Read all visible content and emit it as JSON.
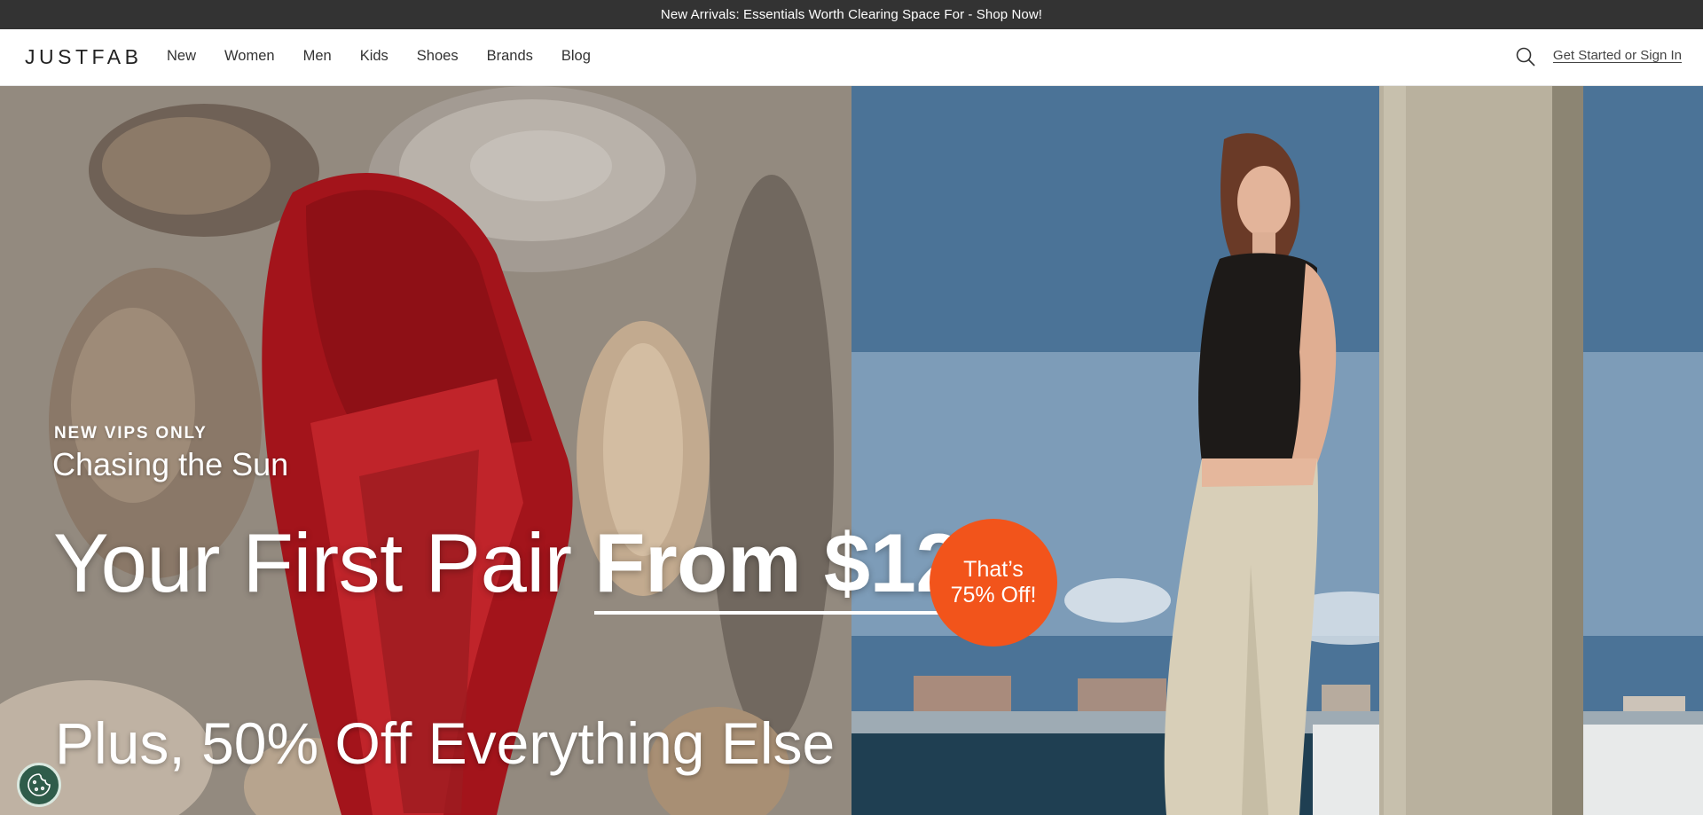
{
  "promo_bar": {
    "text": "New Arrivals: Essentials Worth Clearing Space For - Shop Now!"
  },
  "header": {
    "logo": "JUSTFAB",
    "nav": [
      "New",
      "Women",
      "Men",
      "Kids",
      "Shoes",
      "Brands",
      "Blog"
    ],
    "search_icon": "search-icon",
    "signin_label": "Get Started or Sign In"
  },
  "hero": {
    "eyebrow": "NEW VIPS ONLY",
    "tagline": "Chasing the Sun",
    "headline_plain": "Your First Pair ",
    "headline_highlight": "From $12",
    "subline": "Plus, 50% Off Everything Else",
    "badge_line1": "That’s",
    "badge_line2": "75% Off!"
  },
  "cookie_button": {
    "icon": "cookie-icon"
  },
  "colors": {
    "promo_bg": "#333333",
    "badge": "#f2541b",
    "cookie_bg": "#2f5c4a",
    "sky": "#476f94"
  }
}
